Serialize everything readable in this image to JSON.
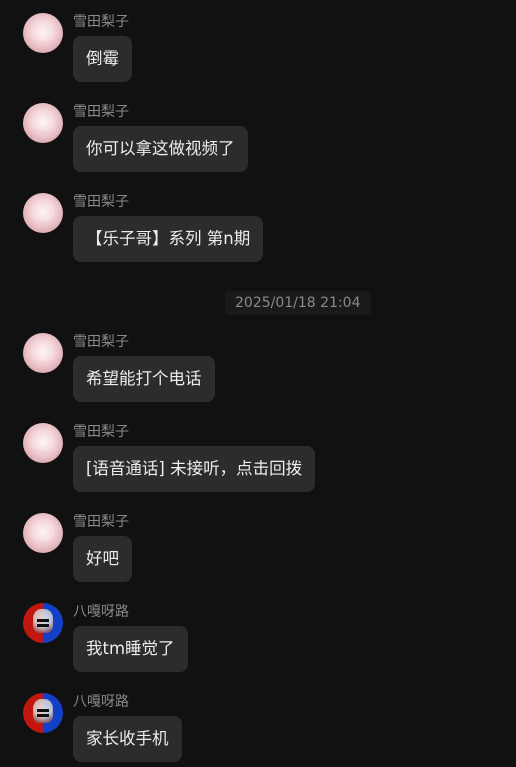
{
  "timestamp": "2025/01/18 21:04",
  "messages": [
    {
      "sender": "雪田梨子",
      "text": "倒霉"
    },
    {
      "sender": "雪田梨子",
      "text": "你可以拿这做视频了"
    },
    {
      "sender": "雪田梨子",
      "text": "【乐子哥】系列 第n期"
    },
    {
      "sender": "雪田梨子",
      "text": "希望能打个电话"
    },
    {
      "sender": "雪田梨子",
      "text": "[语音通话] 未接听，点击回拨"
    },
    {
      "sender": "雪田梨子",
      "text": "好吧"
    },
    {
      "sender": "八嘎呀路",
      "text": "我tm睡觉了"
    },
    {
      "sender": "八嘎呀路",
      "text": "家长收手机"
    }
  ]
}
